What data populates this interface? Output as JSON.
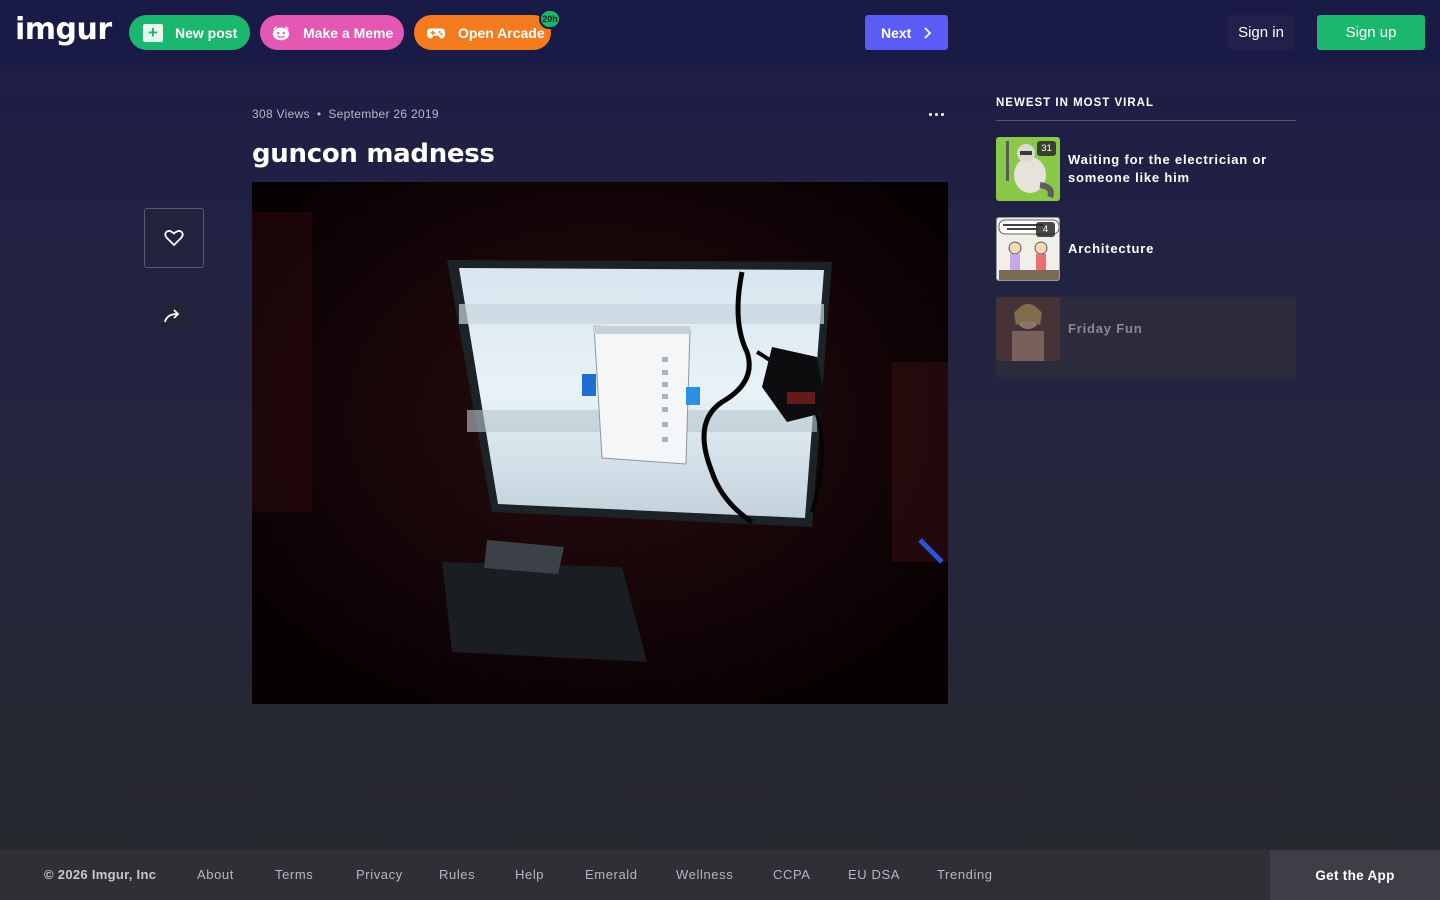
{
  "header": {
    "logo": "imgur",
    "new_post": "New post",
    "make_meme": "Make a Meme",
    "open_arcade": "Open Arcade",
    "arcade_badge": "20h",
    "next": "Next",
    "sign_in": "Sign in",
    "sign_up": "Sign up"
  },
  "post": {
    "views": "308 Views",
    "separator": "•",
    "date": "September 26 2019",
    "title": "guncon madness"
  },
  "sidebar": {
    "heading": "NEWEST IN MOST VIRAL",
    "items": [
      {
        "title": "Waiting for the electrician or someone like him",
        "count": "31",
        "thumb": "raccoon-cartoon"
      },
      {
        "title": "Architecture",
        "count": "4",
        "thumb": "comic-strip"
      },
      {
        "title": "Friday Fun",
        "count": "",
        "thumb": "person-photo"
      }
    ]
  },
  "footer": {
    "copyright": "© 2026 Imgur, Inc",
    "links": [
      "About",
      "Terms",
      "Privacy",
      "Rules",
      "Help",
      "Emerald",
      "Wellness",
      "CCPA",
      "EU DSA",
      "Trending"
    ],
    "get_app": "Get the App"
  },
  "colors": {
    "header_bg": "#1a1a46",
    "green": "#1bb76e",
    "pink": "#e457b2",
    "orange": "#f47c1e",
    "next_blue": "#5a5cf5",
    "footer_bg": "#2e3035"
  },
  "icons": [
    "plus-icon",
    "meme-face-icon",
    "gamepad-icon",
    "chevron-right-icon",
    "ellipsis-icon",
    "heart-icon",
    "share-arrow-icon"
  ]
}
